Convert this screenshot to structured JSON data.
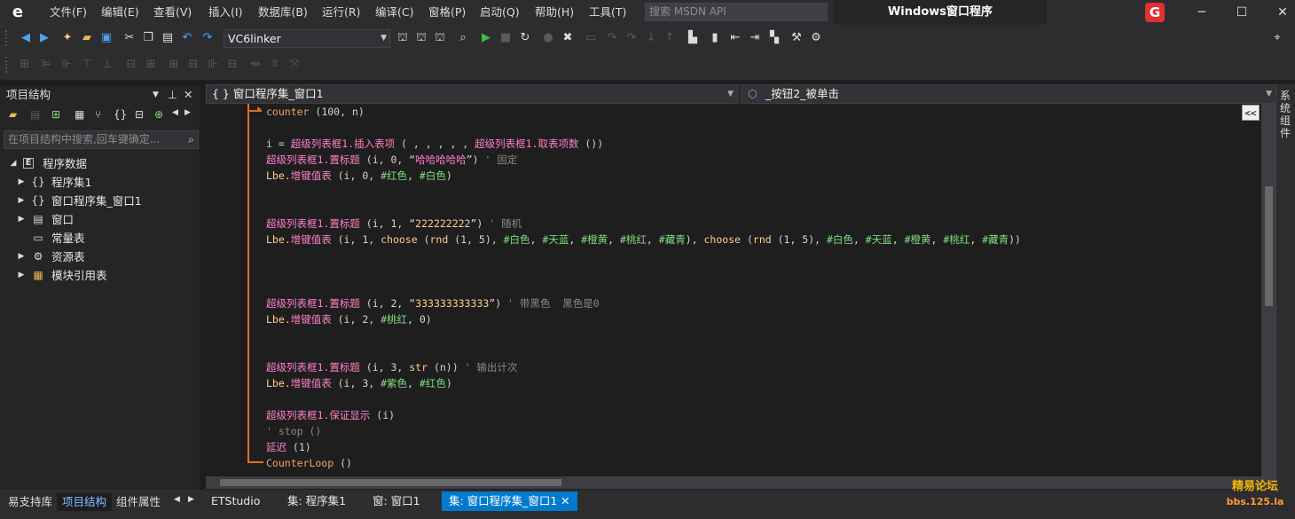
{
  "titlebar": {
    "menus": [
      "文件(F)",
      "编辑(E)",
      "查看(V)",
      "插入(I)",
      "数据库(B)",
      "运行(R)",
      "编译(C)",
      "窗格(P)",
      "启动(Q)",
      "帮助(H)",
      "工具(T)"
    ],
    "search_placeholder": "搜索 MSDN API",
    "window_title": "Windows窗口程序",
    "badge": "G"
  },
  "toolbar": {
    "config_value": "VC6linker"
  },
  "left_panel": {
    "title": "项目结构",
    "search_placeholder": "在项目结构中搜索,回车键确定...",
    "tree": [
      {
        "label": "程序数据",
        "icon": "E",
        "arrow": "◢"
      },
      {
        "label": "程序集1",
        "icon": "{}",
        "arrow": "▶"
      },
      {
        "label": "窗口程序集_窗口1",
        "icon": "{}",
        "arrow": "▶"
      },
      {
        "label": "窗口",
        "icon": "▤",
        "arrow": "▶"
      },
      {
        "label": "常量表",
        "icon": "▭",
        "arrow": ""
      },
      {
        "label": "资源表",
        "icon": "⚙",
        "arrow": "▶"
      },
      {
        "label": "模块引用表",
        "icon": "▦",
        "arrow": "▶"
      }
    ]
  },
  "editor": {
    "scope_combo": "{ } 窗口程序集_窗口1",
    "method_combo": "_按钮2_被单击",
    "collapse_label": "<<"
  },
  "code_lines": [
    {
      "parts": [
        [
          "o",
          "counter"
        ],
        [
          "w",
          " (100, n)"
        ]
      ]
    },
    {
      "parts": []
    },
    {
      "parts": [
        [
          "g",
          "i"
        ],
        [
          "w",
          " = "
        ],
        [
          "k",
          "超级列表框1.插入表项"
        ],
        [
          "w",
          " ( , , , , , "
        ],
        [
          "k",
          "超级列表框1.取表项数"
        ],
        [
          "w",
          " ())"
        ]
      ]
    },
    {
      "parts": [
        [
          "k",
          "超级列表框1.置标题"
        ],
        [
          "w",
          " (i, 0, “"
        ],
        [
          "k",
          "哈哈哈哈哈"
        ],
        [
          "w",
          "”) "
        ],
        [
          "c",
          "' 固定"
        ]
      ]
    },
    {
      "parts": [
        [
          "y",
          "Lbe."
        ],
        [
          "k",
          "增键值表"
        ],
        [
          "w",
          " (i, 0, "
        ],
        [
          "gr",
          "#红色"
        ],
        [
          "w",
          ", "
        ],
        [
          "gr",
          "#白色"
        ],
        [
          "w",
          ")"
        ]
      ]
    },
    {
      "parts": []
    },
    {
      "parts": []
    },
    {
      "parts": [
        [
          "k",
          "超级列表框1.置标题"
        ],
        [
          "w",
          " (i, 1, “"
        ],
        [
          "y",
          "222222222"
        ],
        [
          "w",
          "”) "
        ],
        [
          "c",
          "' 随机"
        ]
      ]
    },
    {
      "parts": [
        [
          "y",
          "Lbe."
        ],
        [
          "k",
          "增键值表"
        ],
        [
          "w",
          " (i, 1, "
        ],
        [
          "y",
          "choose"
        ],
        [
          "w",
          " ("
        ],
        [
          "y",
          "rnd"
        ],
        [
          "w",
          " (1, 5), "
        ],
        [
          "gr",
          "#白色"
        ],
        [
          "w",
          ", "
        ],
        [
          "gr",
          "#天蓝"
        ],
        [
          "w",
          ", "
        ],
        [
          "gr",
          "#橙黄"
        ],
        [
          "w",
          ", "
        ],
        [
          "gr",
          "#桃红"
        ],
        [
          "w",
          ", "
        ],
        [
          "gr",
          "#藏青"
        ],
        [
          "w",
          "), "
        ],
        [
          "y",
          "choose"
        ],
        [
          "w",
          " ("
        ],
        [
          "y",
          "rnd"
        ],
        [
          "w",
          " (1, 5), "
        ],
        [
          "gr",
          "#白色"
        ],
        [
          "w",
          ", "
        ],
        [
          "gr",
          "#天蓝"
        ],
        [
          "w",
          ", "
        ],
        [
          "gr",
          "#橙黄"
        ],
        [
          "w",
          ", "
        ],
        [
          "gr",
          "#桃红"
        ],
        [
          "w",
          ", "
        ],
        [
          "gr",
          "#藏青"
        ],
        [
          "w",
          "))"
        ]
      ]
    },
    {
      "parts": []
    },
    {
      "parts": []
    },
    {
      "parts": []
    },
    {
      "parts": [
        [
          "k",
          "超级列表框1.置标题"
        ],
        [
          "w",
          " (i, 2, “"
        ],
        [
          "y",
          "333333333333"
        ],
        [
          "w",
          "”) "
        ],
        [
          "c",
          "' 带黑色  黑色是0"
        ]
      ]
    },
    {
      "parts": [
        [
          "y",
          "Lbe."
        ],
        [
          "k",
          "增键值表"
        ],
        [
          "w",
          " (i, 2, "
        ],
        [
          "gr",
          "#桃红"
        ],
        [
          "w",
          ", 0)"
        ]
      ]
    },
    {
      "parts": []
    },
    {
      "parts": []
    },
    {
      "parts": [
        [
          "k",
          "超级列表框1.置标题"
        ],
        [
          "w",
          " (i, 3, "
        ],
        [
          "y",
          "str"
        ],
        [
          "w",
          " (n)) "
        ],
        [
          "c",
          "' 输出计次"
        ]
      ]
    },
    {
      "parts": [
        [
          "y",
          "Lbe."
        ],
        [
          "k",
          "增键值表"
        ],
        [
          "w",
          " (i, 3, "
        ],
        [
          "gr",
          "#紫色"
        ],
        [
          "w",
          ", "
        ],
        [
          "gr",
          "#红色"
        ],
        [
          "w",
          ")"
        ]
      ]
    },
    {
      "parts": []
    },
    {
      "parts": [
        [
          "k",
          "超级列表框1.保证显示"
        ],
        [
          "w",
          " (i)"
        ]
      ]
    },
    {
      "parts": [
        [
          "c",
          "' stop ()"
        ]
      ]
    },
    {
      "parts": [
        [
          "k",
          "延迟"
        ],
        [
          "w",
          " (1)"
        ]
      ]
    },
    {
      "parts": [
        [
          "o",
          "CounterLoop"
        ],
        [
          "w",
          " ()"
        ]
      ]
    }
  ],
  "bottom": {
    "panel_tabs": [
      "易支持库",
      "项目结构",
      "组件属性"
    ],
    "editor_tabs": [
      "ETStudio",
      "集: 程序集1",
      "窗: 窗口1",
      "集: 窗口程序集_窗口1"
    ],
    "close_glyph": "✕"
  },
  "right_strip_label": "系统组件",
  "watermark": [
    "精易论坛",
    "bbs.125.la"
  ]
}
